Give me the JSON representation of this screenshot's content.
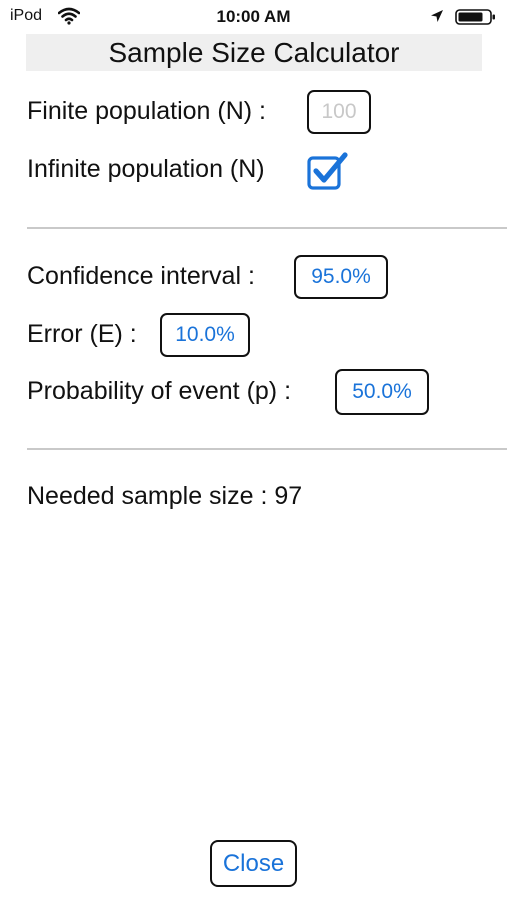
{
  "status_bar": {
    "device": "iPod",
    "time": "10:00 AM",
    "icons": [
      "wifi-icon",
      "location-arrow-icon",
      "battery-icon"
    ]
  },
  "title": "Sample Size Calculator",
  "population": {
    "finite_label": "Finite population (N) :",
    "finite_value": "",
    "finite_placeholder": "100",
    "infinite_label": "Infinite population (N)",
    "infinite_checked": true
  },
  "parameters": {
    "confidence_label": "Confidence interval :",
    "confidence_value": "95.0%",
    "error_label": "Error (E) :",
    "error_value": "10.0%",
    "probability_label": "Probability of event (p) :",
    "probability_value": "50.0%"
  },
  "result": {
    "text": "Needed sample size : 97"
  },
  "close_label": "Close",
  "colors": {
    "accent": "#1a73d9",
    "title_background": "#efefef",
    "divider": "#c9c9c9",
    "placeholder": "#c8c8c8"
  }
}
